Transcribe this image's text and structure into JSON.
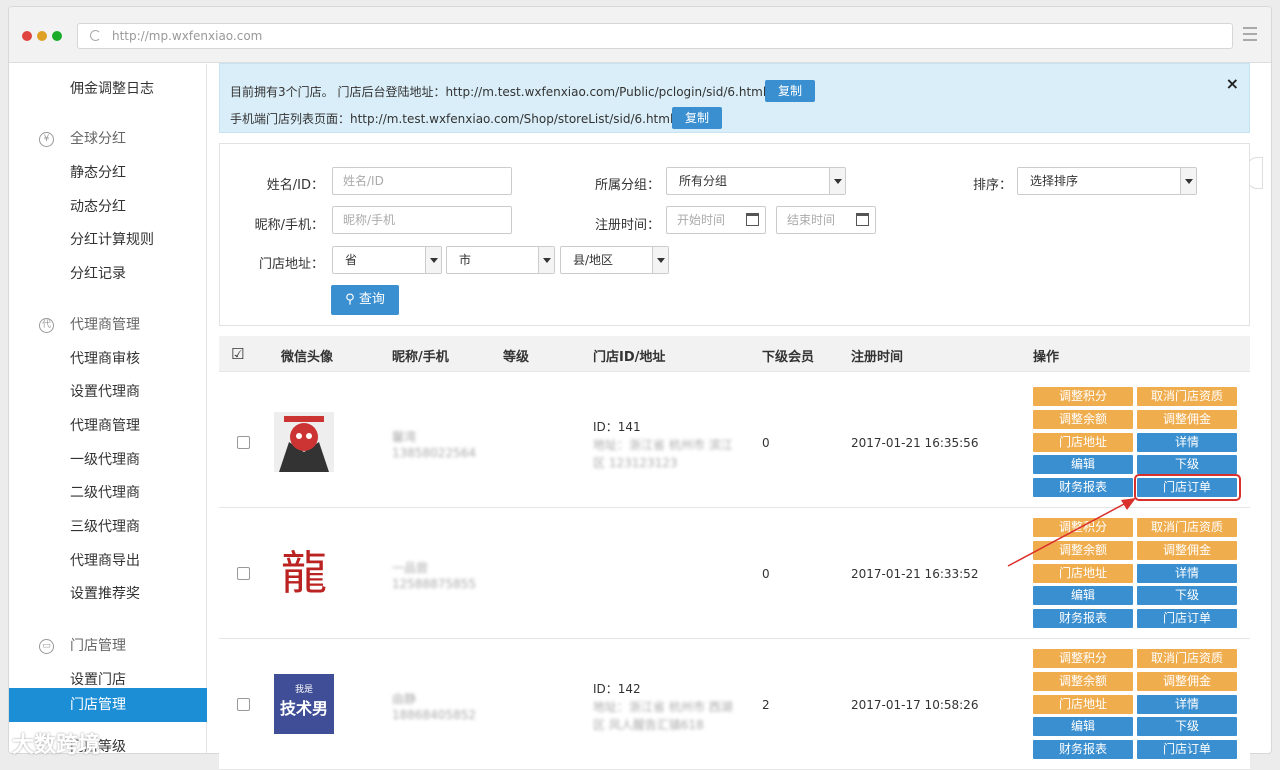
{
  "browser": {
    "url": "http://mp.wxfenxiao.com"
  },
  "sidebar": {
    "items": [
      {
        "label": "佣金调整日志",
        "type": "item"
      },
      {
        "label": "全球分红",
        "type": "group",
        "icon": "yen-icon"
      },
      {
        "label": "静态分红",
        "type": "item"
      },
      {
        "label": "动态分红",
        "type": "item"
      },
      {
        "label": "分红计算规则",
        "type": "item"
      },
      {
        "label": "分红记录",
        "type": "item"
      },
      {
        "label": "代理商管理",
        "type": "group",
        "icon": "agent-icon"
      },
      {
        "label": "代理商审核",
        "type": "item"
      },
      {
        "label": "设置代理商",
        "type": "item"
      },
      {
        "label": "代理商管理",
        "type": "item"
      },
      {
        "label": "一级代理商",
        "type": "item"
      },
      {
        "label": "二级代理商",
        "type": "item"
      },
      {
        "label": "三级代理商",
        "type": "item"
      },
      {
        "label": "代理商导出",
        "type": "item"
      },
      {
        "label": "设置推荐奖",
        "type": "item"
      },
      {
        "label": "门店管理",
        "type": "group",
        "icon": "store-icon"
      },
      {
        "label": "设置门店",
        "type": "item"
      },
      {
        "label": "门店管理",
        "type": "active"
      },
      {
        "label": "门店等级",
        "type": "item"
      }
    ]
  },
  "notice": {
    "line1": "目前拥有3个门店。 门店后台登陆地址：http://m.test.wxfenxiao.com/Public/pclogin/sid/6.html",
    "line2": "手机端门店列表页面：http://m.test.wxfenxiao.com/Shop/storeList/sid/6.html",
    "copy_label": "复制",
    "close": "×"
  },
  "filter": {
    "name_label": "姓名/ID：",
    "name_placeholder": "姓名/ID",
    "nick_label": "昵称/手机：",
    "nick_placeholder": "昵称/手机",
    "addr_label": "门店地址：",
    "province": "省",
    "city": "市",
    "county": "县/地区",
    "group_label": "所属分组：",
    "group_value": "所有分组",
    "reg_label": "注册时间：",
    "start_placeholder": "开始时间",
    "end_placeholder": "结束时间",
    "sort_label": "排序：",
    "sort_value": "选择排序",
    "search_label": "查询"
  },
  "table": {
    "headers": [
      "微信头像",
      "昵称/手机",
      "等级",
      "门店ID/地址",
      "下级会员",
      "注册时间",
      "操作"
    ],
    "actions": [
      {
        "label": "调整积分",
        "color": "#f0ad4e"
      },
      {
        "label": "取消门店资质",
        "color": "#f0ad4e"
      },
      {
        "label": "调整余额",
        "color": "#f0ad4e"
      },
      {
        "label": "调整佣金",
        "color": "#f0ad4e"
      },
      {
        "label": "门店地址",
        "color": "#f0ad4e"
      },
      {
        "label": "详情",
        "color": "#3a8fd0"
      },
      {
        "label": "编辑",
        "color": "#3a8fd0"
      },
      {
        "label": "下级",
        "color": "#3a8fd0"
      },
      {
        "label": "财务报表",
        "color": "#3a8fd0"
      },
      {
        "label": "门店订单",
        "color": "#3a8fd0"
      }
    ],
    "rows": [
      {
        "nick": "馨湾",
        "phone": "13858022564",
        "store_id": "ID：141",
        "addr1": "地址：浙江省 杭州市 滨江",
        "addr2": "区 123123123",
        "sub": "0",
        "date": "2017-01-21 16:35:56"
      },
      {
        "nick": "一品尝",
        "phone": "12588875855",
        "store_id": "",
        "addr1": "",
        "addr2": "",
        "sub": "0",
        "date": "2017-01-21 16:33:52"
      },
      {
        "nick": "由静",
        "phone": "18868405852",
        "store_id": "ID：142",
        "addr1": "地址：浙江省 杭州市 西湖",
        "addr2": "区 风人醒告汇镇618",
        "sub": "2",
        "date": "2017-01-17 10:58:26"
      }
    ]
  },
  "avatars": {
    "row3_top": "我是",
    "row3_main": "技术男",
    "row2_glyph": "龍"
  },
  "watermark": "大数跨境"
}
